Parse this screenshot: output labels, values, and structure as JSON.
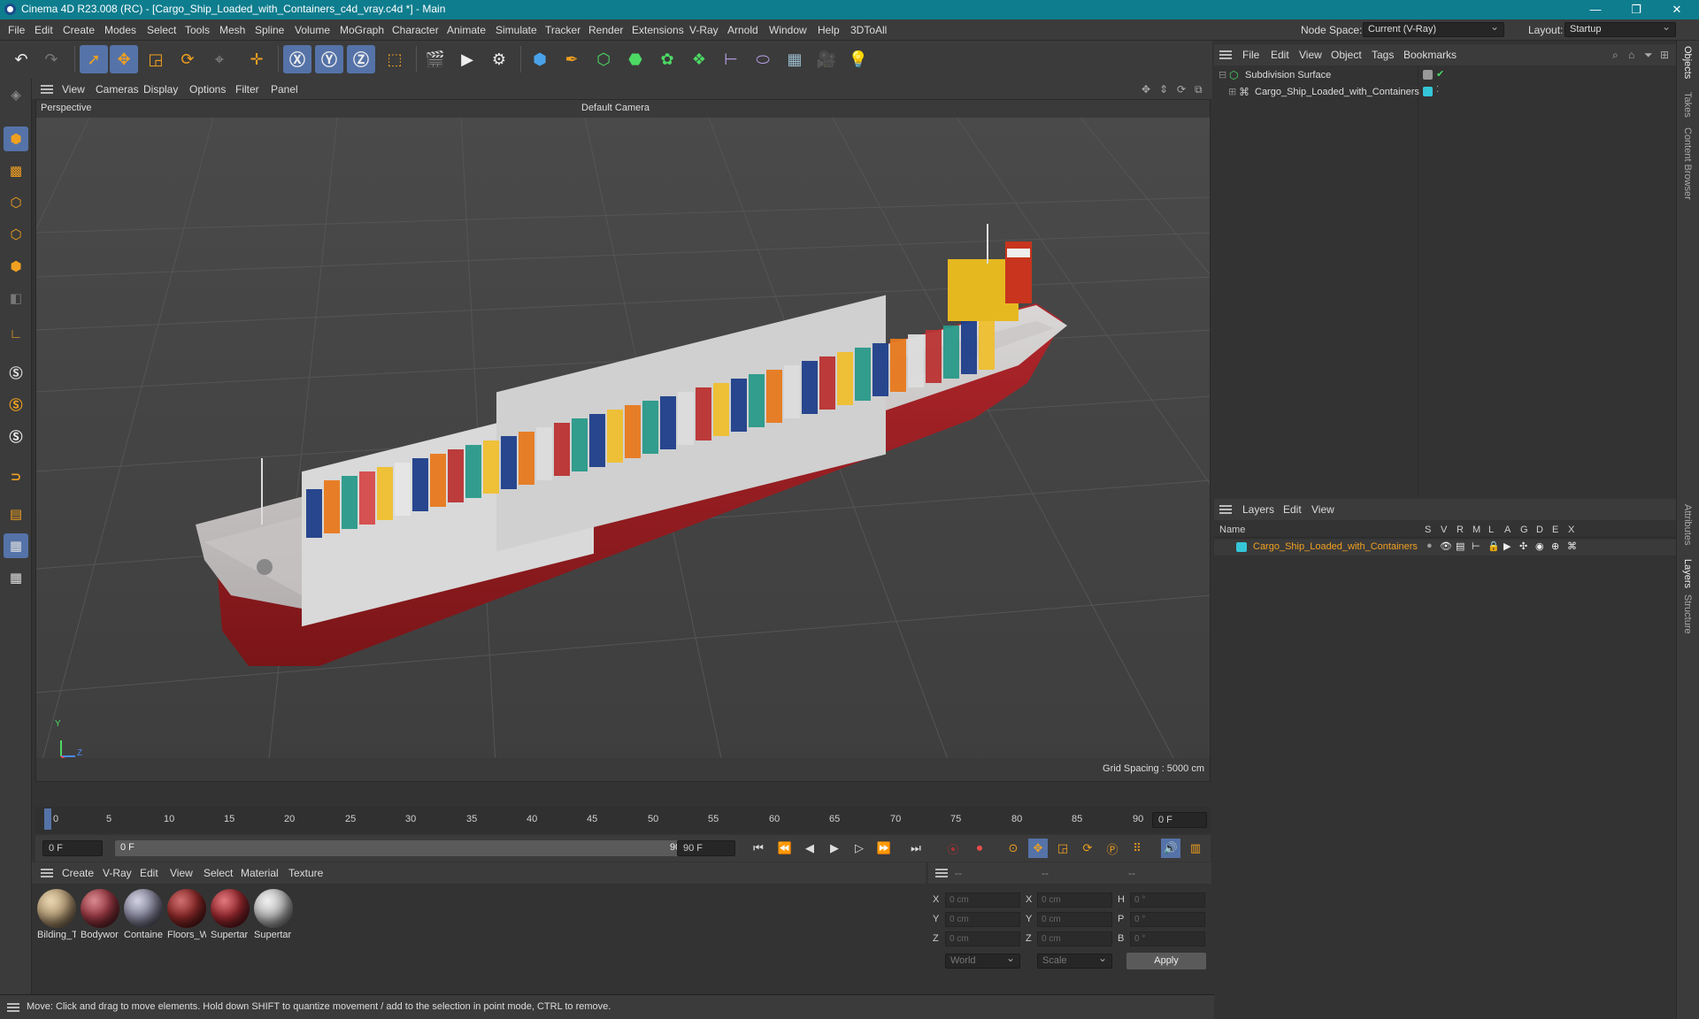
{
  "window": {
    "title": "Cinema 4D R23.008 (RC) - [Cargo_Ship_Loaded_with_Containers_c4d_vray.c4d *] - Main",
    "minimize": "—",
    "restore": "❐",
    "close": "✕"
  },
  "menubar": {
    "items": [
      "File",
      "Edit",
      "Create",
      "Modes",
      "Select",
      "Tools",
      "Mesh",
      "Spline",
      "Volume",
      "MoGraph",
      "Character",
      "Animate",
      "Simulate",
      "Tracker",
      "Render",
      "Extensions",
      "V-Ray",
      "Arnold",
      "Window",
      "Help",
      "3DToAll"
    ],
    "node_space_label": "Node Space:",
    "node_space_value": "Current (V-Ray)",
    "layout_label": "Layout:",
    "layout_value": "Startup"
  },
  "viewport": {
    "menu": [
      "View",
      "Cameras",
      "Display",
      "Options",
      "Filter",
      "Panel"
    ],
    "label": "Perspective",
    "camera": "Default Camera",
    "grid_spacing": "Grid Spacing : 5000 cm",
    "axis_y": "Y",
    "axis_z": "Z",
    "axis_x": "X"
  },
  "timeline": {
    "ticks": [
      "0",
      "5",
      "10",
      "15",
      "20",
      "25",
      "30",
      "35",
      "40",
      "45",
      "50",
      "55",
      "60",
      "65",
      "70",
      "75",
      "80",
      "85",
      "90"
    ],
    "current_frame": "0 F",
    "start": "0 F",
    "range_start": "0 F",
    "range_end": "90 F",
    "end": "90 F",
    "end2": "90 F"
  },
  "materials": {
    "menu": [
      "Create",
      "V-Ray",
      "Edit",
      "View",
      "Select",
      "Material",
      "Texture"
    ],
    "items": [
      {
        "name": "Bilding_T",
        "color": "#b9a07a"
      },
      {
        "name": "Bodywor",
        "color": "#9b3a44"
      },
      {
        "name": "Containe",
        "color": "#8a8aa0"
      },
      {
        "name": "Floors_W",
        "color": "#8e2a2a"
      },
      {
        "name": "Supertar",
        "color": "#9a2a30"
      },
      {
        "name": "Supertar",
        "color": "#bdbdbd"
      }
    ]
  },
  "attributes": {
    "header": [
      "--",
      "--",
      "--"
    ],
    "rows": [
      {
        "l1": "X",
        "v1": "0 cm",
        "l2": "X",
        "v2": "0 cm",
        "l3": "H",
        "v3": "0 °"
      },
      {
        "l1": "Y",
        "v1": "0 cm",
        "l2": "Y",
        "v2": "0 cm",
        "l3": "P",
        "v3": "0 °"
      },
      {
        "l1": "Z",
        "v1": "0 cm",
        "l2": "Z",
        "v2": "0 cm",
        "l3": "B",
        "v3": "0 °"
      }
    ],
    "coord_mode": "World",
    "size_mode": "Scale",
    "apply": "Apply"
  },
  "status": "Move: Click and drag to move elements. Hold down SHIFT to quantize movement / add to the selection in point mode, CTRL to remove.",
  "objects": {
    "menu": [
      "File",
      "Edit",
      "View",
      "Object",
      "Tags",
      "Bookmarks"
    ],
    "items": [
      {
        "name": "Subdivision Surface"
      },
      {
        "name": "Cargo_Ship_Loaded_with_Containers"
      }
    ]
  },
  "layers": {
    "menu": [
      "Layers",
      "Edit",
      "View"
    ],
    "columns": [
      "Name",
      "S",
      "V",
      "R",
      "M",
      "L",
      "A",
      "G",
      "D",
      "E",
      "X"
    ],
    "rows": [
      {
        "name": "Cargo_Ship_Loaded_with_Containers",
        "color": "#35c6d8"
      }
    ]
  },
  "sidetabs": [
    "Objects",
    "Takes",
    "Content Browser",
    "Attributes",
    "Layers",
    "Structure"
  ]
}
